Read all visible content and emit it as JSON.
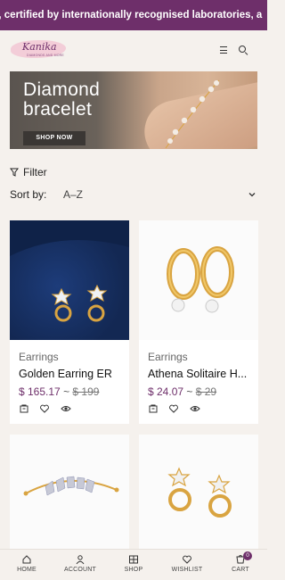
{
  "announcement": {
    "text": "s, certified by internationally recognised laboratories, a"
  },
  "header": {
    "logo_text": "Kanika",
    "logo_tagline": "DIAMONDS AND MORE"
  },
  "banner": {
    "title_line1": "Diamond",
    "title_line2": "bracelet",
    "button_label": "SHOP NOW"
  },
  "toolbar": {
    "filter_label": "Filter",
    "sort_label": "Sort by:",
    "sort_value": "A–Z"
  },
  "products": [
    {
      "category": "Earrings",
      "name": "Golden Earring ER",
      "price": "$ 165.17",
      "separator": "~",
      "old_price": "$ 199"
    },
    {
      "category": "Earrings",
      "name": "Athena Solitaire H...",
      "price": "$ 24.07",
      "separator": "~",
      "old_price": "$ 29"
    },
    {
      "category": "",
      "name": "",
      "price": "",
      "separator": "",
      "old_price": ""
    },
    {
      "category": "",
      "name": "",
      "price": "",
      "separator": "",
      "old_price": ""
    }
  ],
  "bottom_nav": {
    "home": "HOME",
    "account": "ACCOUNT",
    "shop": "SHOP",
    "wishlist": "WISHLIST",
    "cart": "CART",
    "cart_count": "0"
  },
  "colors": {
    "brand": "#6e2f6a",
    "background": "#f5f1ed",
    "gold": "#d9a441"
  },
  "icons": [
    "menu-icon",
    "search-icon",
    "filter-icon",
    "chevron-down-icon",
    "cart-add-icon",
    "heart-icon",
    "eye-icon",
    "home-icon",
    "user-icon",
    "shop-icon",
    "cart-icon"
  ]
}
